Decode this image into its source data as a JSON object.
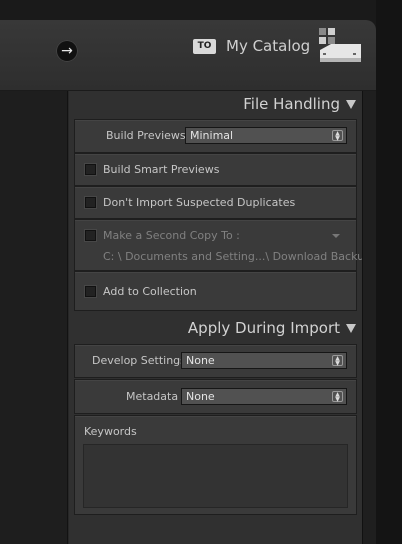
{
  "header": {
    "to_label": "TO",
    "catalog_name": "My Catalog"
  },
  "file_handling": {
    "title": "File Handling",
    "build_previews_label": "Build Previews",
    "build_previews_value": "Minimal",
    "build_smart_previews_label": "Build Smart Previews",
    "dont_import_duplicates_label": "Don't Import Suspected Duplicates",
    "second_copy_label": "Make a Second Copy To :",
    "second_copy_path": "C: \\ Documents and Setting...\\ Download Backups",
    "add_to_collection_label": "Add to Collection"
  },
  "apply_during_import": {
    "title": "Apply During Import",
    "develop_settings_label": "Develop Settings",
    "develop_settings_value": "None",
    "metadata_label": "Metadata",
    "metadata_value": "None",
    "keywords_label": "Keywords"
  }
}
